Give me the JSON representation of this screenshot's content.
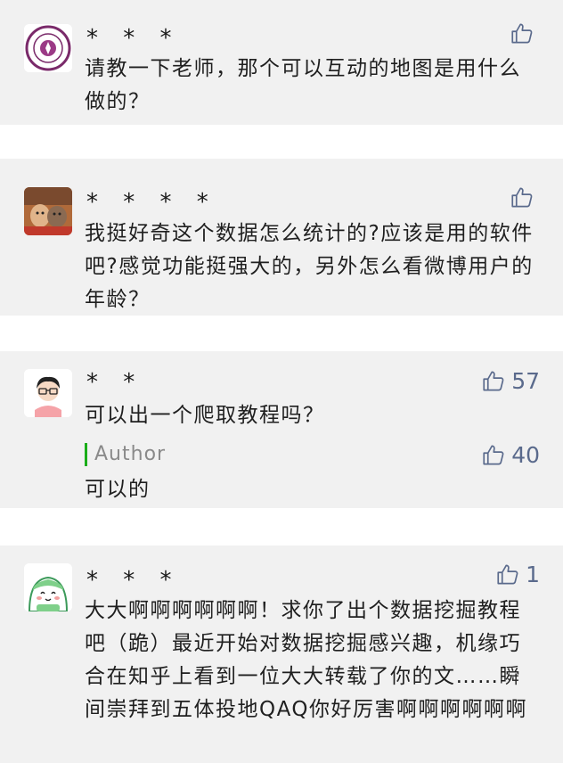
{
  "comments": [
    {
      "name": "* * *",
      "text": "请教一下老师，那个可以互动的地图是用什么做的？",
      "likes": ""
    },
    {
      "name": "* * * *",
      "text": "我挺好奇这个数据怎么统计的?应该是用的软件吧?感觉功能挺强大的，另外怎么看微博用户的年龄？",
      "likes": ""
    },
    {
      "name": "* *",
      "text": "可以出一个爬取教程吗？",
      "likes": "57",
      "reply": {
        "tag": "Author",
        "text": "可以的",
        "likes": "40"
      }
    },
    {
      "name": "* * *",
      "text": "大大啊啊啊啊啊啊！求你了出个数据挖掘教程吧（跪）最近开始对数据挖掘感兴趣，机缘巧合在知乎上看到一位大大转载了你的文……瞬间崇拜到五体投地QAQ你好厉害啊啊啊啊啊啊",
      "likes": "1"
    }
  ],
  "colors": {
    "card_bg": "#f1f1f1",
    "like_color": "#5a6a8c",
    "author_bar": "#1aad19"
  },
  "icons": {
    "like": "thumbs-up-icon"
  }
}
